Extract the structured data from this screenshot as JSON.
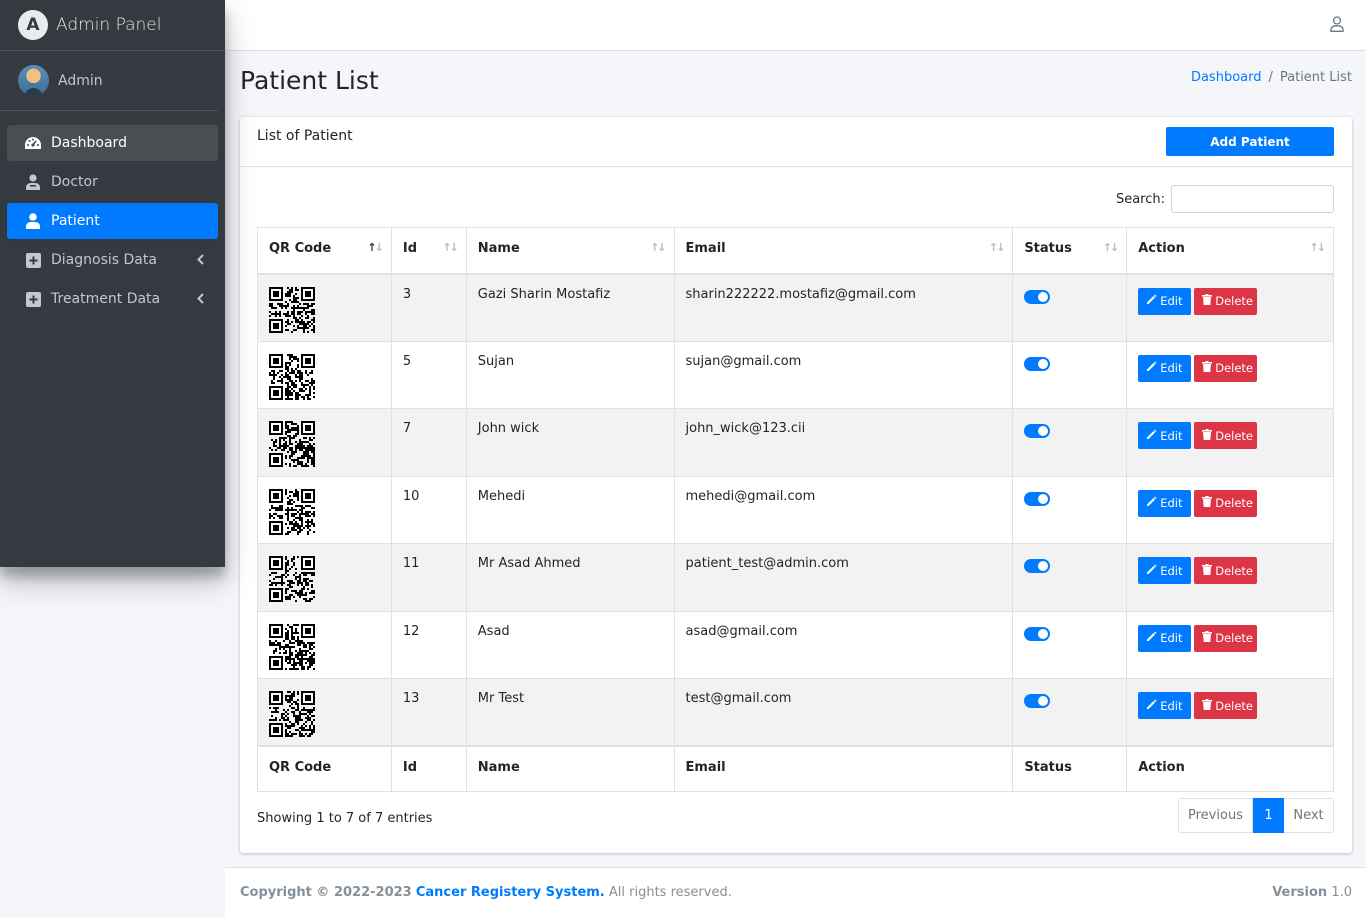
{
  "brand": {
    "logo_letter": "A",
    "title": "Admin Panel"
  },
  "user": {
    "name": "Admin"
  },
  "sidebar": {
    "items": [
      {
        "label": "Dashboard",
        "icon": "tachometer-icon"
      },
      {
        "label": "Doctor",
        "icon": "user-md-icon"
      },
      {
        "label": "Patient",
        "icon": "user-icon"
      },
      {
        "label": "Diagnosis Data",
        "icon": "plus-square-icon"
      },
      {
        "label": "Treatment Data",
        "icon": "plus-square-icon"
      }
    ]
  },
  "page": {
    "title": "Patient List",
    "breadcrumb": {
      "home": "Dashboard",
      "current": "Patient List"
    }
  },
  "card": {
    "title": "List of Patient",
    "add_button": "Add Patient",
    "search_label": "Search:"
  },
  "table": {
    "headers": [
      "QR Code",
      "Id",
      "Name",
      "Email",
      "Status",
      "Action"
    ],
    "rows": [
      {
        "id": "3",
        "name": "Gazi Sharin Mostafiz",
        "email": "sharin222222.mostafiz@gmail.com"
      },
      {
        "id": "5",
        "name": "Sujan",
        "email": "sujan@gmail.com"
      },
      {
        "id": "7",
        "name": "John wick",
        "email": "john_wick@123.cii"
      },
      {
        "id": "10",
        "name": "Mehedi",
        "email": "mehedi@gmail.com"
      },
      {
        "id": "11",
        "name": "Mr Asad Ahmed",
        "email": "patient_test@admin.com"
      },
      {
        "id": "12",
        "name": "Asad",
        "email": "asad@gmail.com"
      },
      {
        "id": "13",
        "name": "Mr Test",
        "email": "test@gmail.com"
      }
    ],
    "edit_label": "Edit",
    "delete_label": "Delete"
  },
  "pagination": {
    "info": "Showing 1 to 7 of 7 entries",
    "previous": "Previous",
    "current": "1",
    "next": "Next"
  },
  "footer": {
    "copyright": "Copyright © 2022-2023",
    "system_name": "Cancer Registery System.",
    "rights": "All rights reserved.",
    "version_label": "Version",
    "version": "1.0"
  },
  "colors": {
    "primary": "#007bff",
    "danger": "#dc3545",
    "sidebar": "#343a40"
  }
}
